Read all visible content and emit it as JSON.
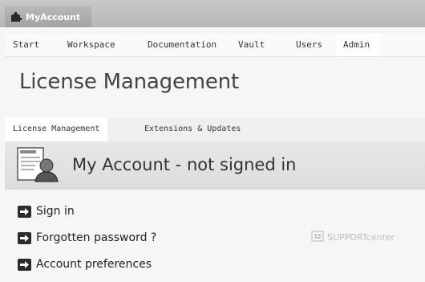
{
  "app": {
    "tab_title": "MyAccount"
  },
  "nav": {
    "items": [
      "Start",
      "Workspace",
      "Documentation",
      "Vault",
      "Users",
      "Admin"
    ],
    "active": "Admin"
  },
  "page": {
    "title": "License Management"
  },
  "subnav": {
    "items": [
      "License Management",
      "Extensions & Updates"
    ],
    "active": "License Management"
  },
  "account": {
    "heading": "My Account - not signed in",
    "links": [
      "Sign in",
      "Forgotten password ?",
      "Account preferences"
    ]
  },
  "support": {
    "label": "SUPPORTcenter"
  },
  "icons": {
    "app": "puzzle-icon",
    "account": "user-document-icon",
    "link": "arrow-right-icon",
    "support": "support-icon"
  }
}
